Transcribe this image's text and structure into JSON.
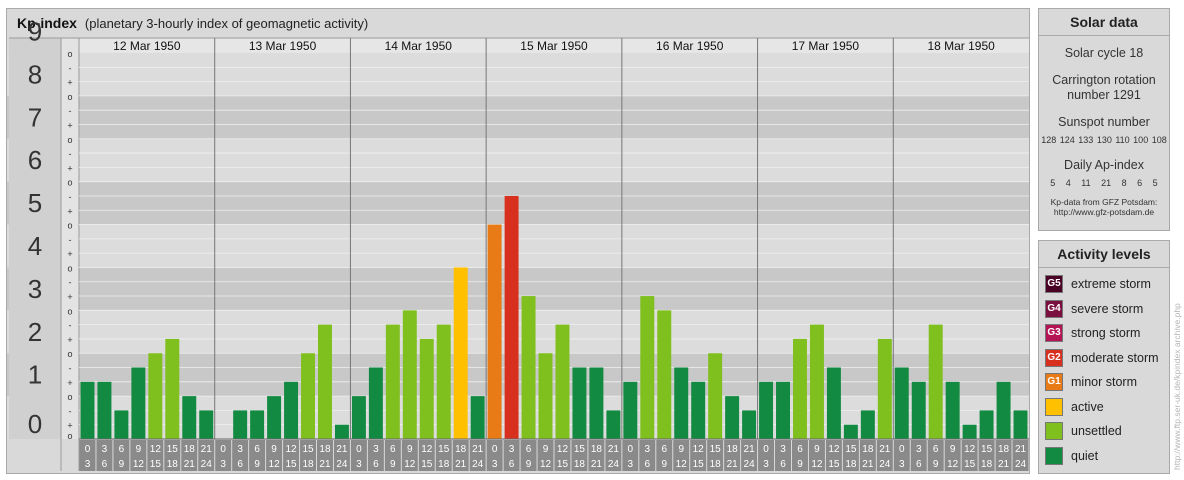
{
  "header": {
    "title": "Kp-index",
    "subtitle": "(planetary 3-hourly index of geomagnetic activity)"
  },
  "chart_data": {
    "type": "bar",
    "ylim": [
      0,
      9
    ],
    "y_ticks": [
      "0",
      "1",
      "2",
      "3",
      "4",
      "5",
      "6",
      "7",
      "8",
      "9"
    ],
    "sub_ticks": [
      "-",
      "o",
      "+"
    ],
    "days": [
      "12 Mar 1950",
      "13 Mar 1950",
      "14 Mar 1950",
      "15 Mar 1950",
      "16 Mar 1950",
      "17 Mar 1950",
      "18 Mar 1950"
    ],
    "hour_top": [
      "0",
      "3",
      "6",
      "9",
      "12",
      "15",
      "18",
      "21"
    ],
    "hour_bottom": [
      "3",
      "6",
      "9",
      "12",
      "15",
      "18",
      "21",
      "24"
    ],
    "values": [
      [
        1.333,
        1.333,
        0.667,
        1.667,
        2.0,
        2.333,
        1.0,
        0.667
      ],
      [
        0.0,
        0.667,
        0.667,
        1.0,
        1.333,
        2.0,
        2.667,
        0.333
      ],
      [
        1.0,
        1.667,
        2.667,
        3.0,
        2.333,
        2.667,
        4.0,
        1.0
      ],
      [
        5.0,
        5.667,
        3.333,
        2.0,
        2.667,
        1.667,
        1.667,
        0.667
      ],
      [
        1.333,
        3.333,
        3.0,
        1.667,
        1.333,
        2.0,
        1.0,
        0.667
      ],
      [
        1.333,
        1.333,
        2.333,
        2.667,
        1.667,
        0.333,
        0.667,
        2.333
      ],
      [
        1.667,
        1.333,
        2.667,
        1.333,
        0.333,
        0.667,
        1.333,
        0.667
      ]
    ],
    "level_colors": {
      "quiet": "#138a41",
      "unsettled": "#7fbf1e",
      "active": "#ffc000",
      "g1": "#e97b16",
      "g2": "#d8301f"
    }
  },
  "solar": {
    "title": "Solar data",
    "cycle": "Solar cycle 18",
    "carrington_1": "Carrington rotation",
    "carrington_2": "number 1291",
    "sunspot_label": "Sunspot number",
    "sunspot_values": "128 124 133 130 110 100 108",
    "ap_label": "Daily Ap-index",
    "ap_values": "5   4   11   21   8   6   5",
    "credit_1": "Kp-data from GFZ Potsdam:",
    "credit_2": "http://www.gfz-potsdam.de"
  },
  "activity": {
    "title": "Activity levels",
    "items": [
      {
        "badge": "G5",
        "label": "extreme storm",
        "color": "#4a0126"
      },
      {
        "badge": "G4",
        "label": "severe storm",
        "color": "#7a0f3f"
      },
      {
        "badge": "G3",
        "label": "strong storm",
        "color": "#b41354"
      },
      {
        "badge": "G2",
        "label": "moderate storm",
        "color": "#d8301f"
      },
      {
        "badge": "G1",
        "label": "minor storm",
        "color": "#e97b16"
      },
      {
        "badge": "",
        "label": "active",
        "color": "#ffc000"
      },
      {
        "badge": "",
        "label": "unsettled",
        "color": "#7fbf1e"
      },
      {
        "badge": "",
        "label": "quiet",
        "color": "#138a41"
      }
    ]
  },
  "watermark": "http://www.ftp.ser-uk.de/kpindex archive.php"
}
